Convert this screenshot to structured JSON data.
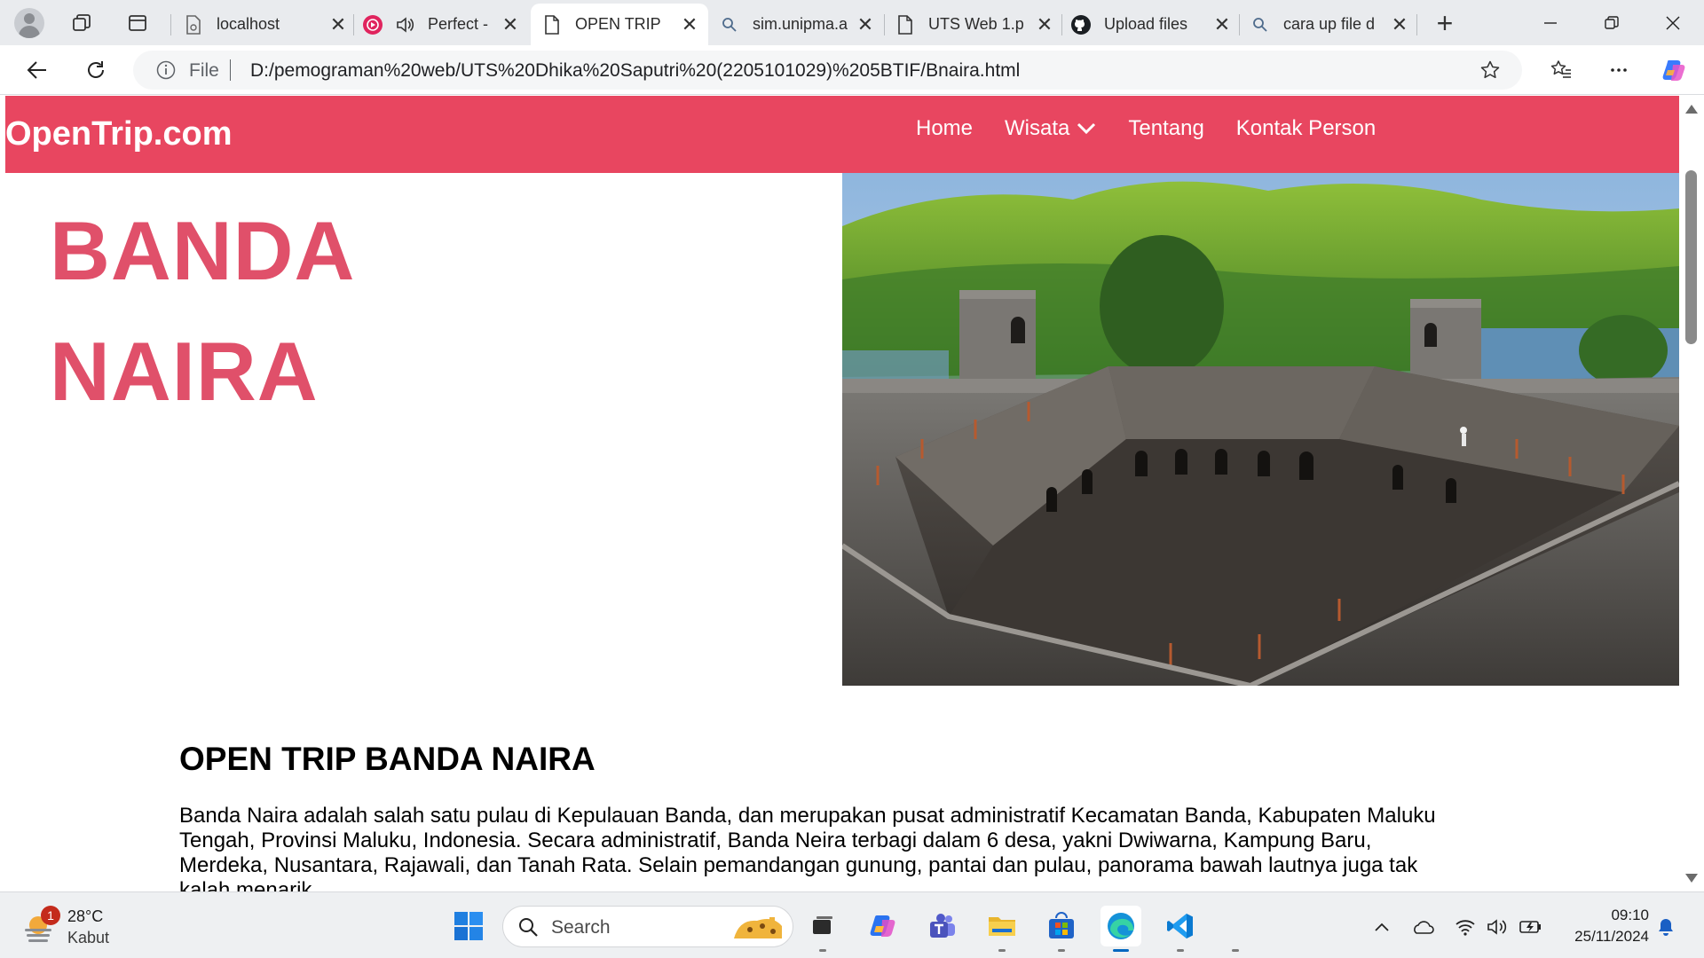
{
  "browser": {
    "tabs": [
      {
        "label": "localhost",
        "icon": "broken-page-icon",
        "active": false
      },
      {
        "label": "Perfect -",
        "icon": "music-red-icon",
        "active": false
      },
      {
        "label": "OPEN TRIP",
        "icon": "page-icon",
        "active": true
      },
      {
        "label": "sim.unipma.a",
        "icon": "search-icon",
        "active": false
      },
      {
        "label": "UTS Web 1.p",
        "icon": "page-icon",
        "active": false
      },
      {
        "label": "Upload files",
        "icon": "github-icon",
        "active": false
      },
      {
        "label": "cara up file d",
        "icon": "search-icon",
        "active": false
      }
    ],
    "close_glyph": "✕",
    "new_tab_glyph": "+",
    "address": {
      "scheme_label": "File",
      "url": "D:/pemograman%20web/UTS%20Dhika%20Saputri%20(2205101029)%205BTIF/Bnaira.html"
    }
  },
  "site": {
    "brand": "OpenTrip.com",
    "nav": [
      {
        "label": "Home"
      },
      {
        "label": "Wisata",
        "has_dropdown": true
      },
      {
        "label": "Tentang"
      },
      {
        "label": "Kontak Person"
      }
    ],
    "hero": {
      "line1": "BANDA",
      "line2": "NAIRA"
    },
    "section": {
      "heading": "OPEN TRIP BANDA NAIRA",
      "body": "Banda Naira adalah salah satu pulau di Kepulauan Banda, dan merupakan pusat administratif Kecamatan Banda, Kabupaten Maluku Tengah, Provinsi Maluku, Indonesia. Secara administratif, Banda Neira terbagi dalam 6 desa, yakni Dwiwarna, Kampung Baru, Merdeka, Nusantara, Rajawali, dan Tanah Rata. Selain pemandangan gunung, pantai dan pulau, panorama bawah lautnya juga tak kalah menarik."
    },
    "colors": {
      "nav_bg": "#e84660",
      "hero_text": "#e0506a"
    }
  },
  "taskbar": {
    "weather": {
      "temp": "28°C",
      "condition": "Kabut",
      "badge": "1"
    },
    "search_placeholder": "Search",
    "clock": {
      "time": "09:10",
      "date": "25/11/2024"
    }
  }
}
